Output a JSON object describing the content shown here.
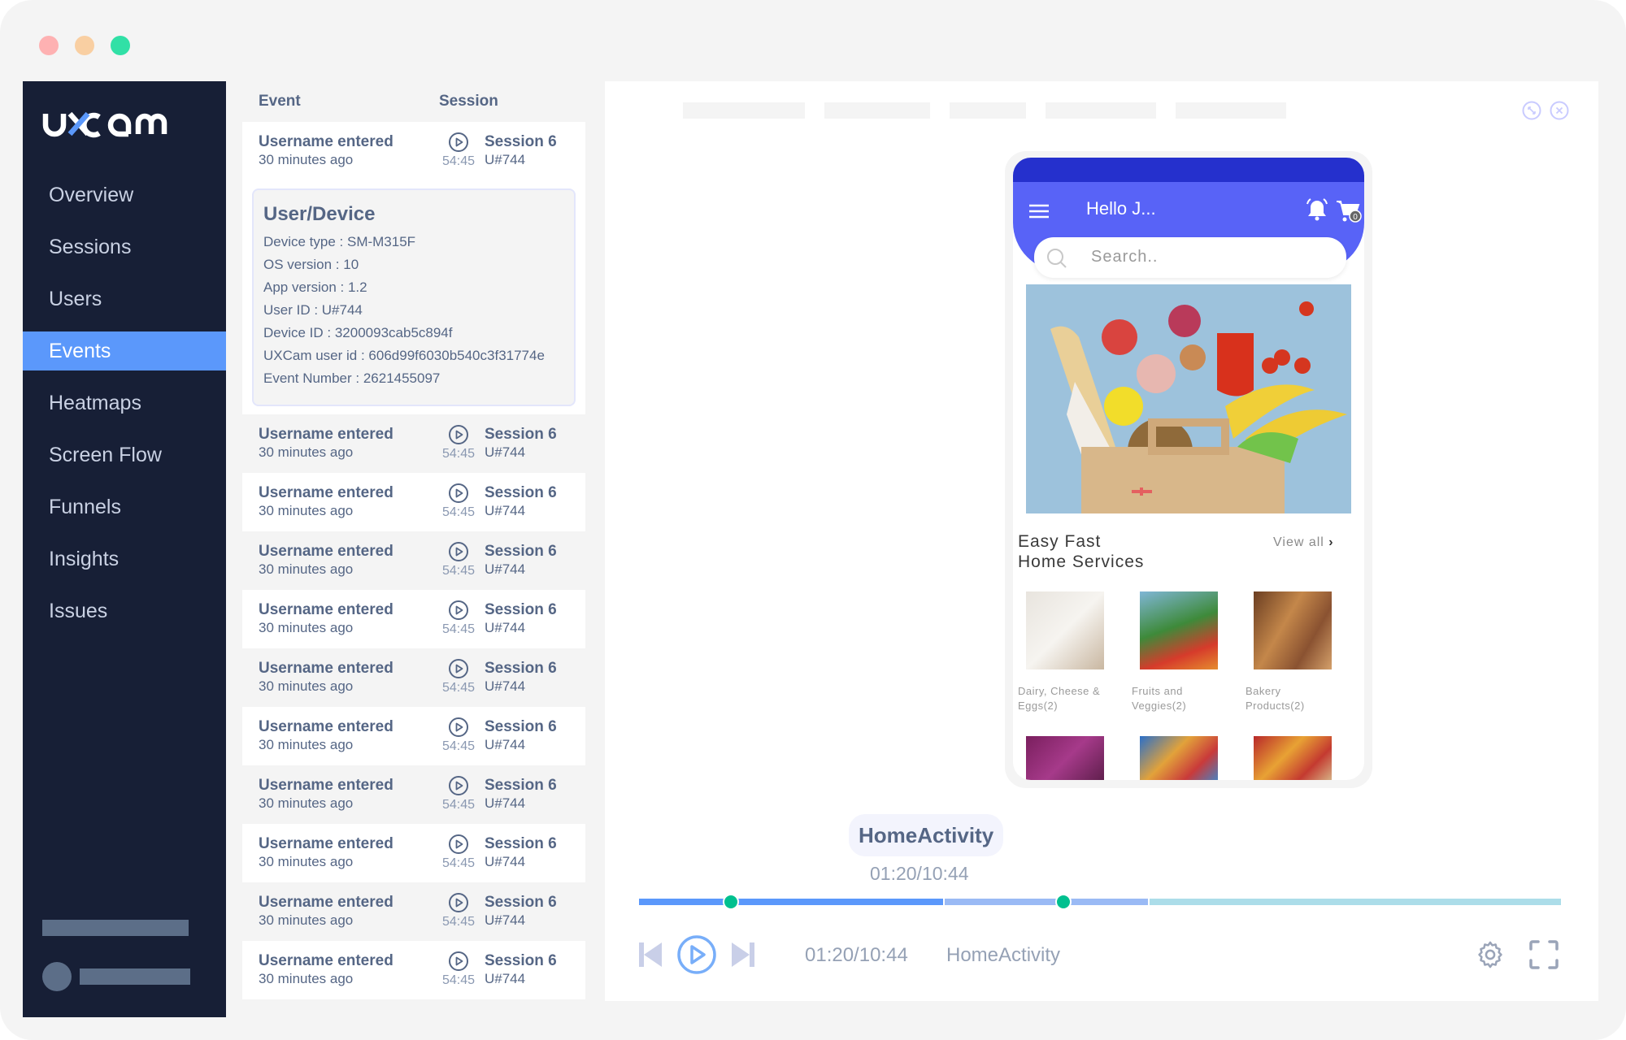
{
  "app": {
    "brand": "uxcam"
  },
  "window_controls": {
    "close_color": "#feb1b2",
    "minimize_color": "#f9cfa2",
    "maximize_color": "#31e0a6"
  },
  "sidebar": {
    "items": [
      {
        "label": "Overview",
        "active": false
      },
      {
        "label": "Sessions",
        "active": false
      },
      {
        "label": "Users",
        "active": false
      },
      {
        "label": "Events",
        "active": true
      },
      {
        "label": "Heatmaps",
        "active": false
      },
      {
        "label": "Screen Flow",
        "active": false
      },
      {
        "label": "Funnels",
        "active": false
      },
      {
        "label": "Insights",
        "active": false
      },
      {
        "label": "Issues",
        "active": false
      }
    ],
    "active_color": "#5b98fb"
  },
  "event_list": {
    "headers": {
      "event": "Event",
      "session": "Session"
    },
    "rows": [
      {
        "event": "Username entered",
        "time_ago": "30 minutes ago",
        "duration": "54:45",
        "session": "Session 6",
        "user": "U#744"
      },
      {
        "event": "Username entered",
        "time_ago": "30 minutes ago",
        "duration": "54:45",
        "session": "Session 6",
        "user": "U#744"
      },
      {
        "event": "Username entered",
        "time_ago": "30 minutes ago",
        "duration": "54:45",
        "session": "Session 6",
        "user": "U#744"
      },
      {
        "event": "Username entered",
        "time_ago": "30 minutes ago",
        "duration": "54:45",
        "session": "Session 6",
        "user": "U#744"
      },
      {
        "event": "Username entered",
        "time_ago": "30 minutes ago",
        "duration": "54:45",
        "session": "Session 6",
        "user": "U#744"
      },
      {
        "event": "Username entered",
        "time_ago": "30 minutes ago",
        "duration": "54:45",
        "session": "Session 6",
        "user": "U#744"
      },
      {
        "event": "Username entered",
        "time_ago": "30 minutes ago",
        "duration": "54:45",
        "session": "Session 6",
        "user": "U#744"
      },
      {
        "event": "Username entered",
        "time_ago": "30 minutes ago",
        "duration": "54:45",
        "session": "Session 6",
        "user": "U#744"
      },
      {
        "event": "Username entered",
        "time_ago": "30 minutes ago",
        "duration": "54:45",
        "session": "Session 6",
        "user": "U#744"
      },
      {
        "event": "Username entered",
        "time_ago": "30 minutes ago",
        "duration": "54:45",
        "session": "Session 6",
        "user": "U#744"
      },
      {
        "event": "Username entered",
        "time_ago": "30 minutes ago",
        "duration": "54:45",
        "session": "Session 6",
        "user": "U#744"
      }
    ],
    "detail": {
      "title": "User/Device",
      "lines": [
        "Device type : SM-M315F",
        "OS version : 10",
        "App version : 1.2",
        "User ID : U#744",
        "Device ID : 3200093cab5c894f",
        "UXCam user id : 606d99f6030b540c3f31774e",
        "Event Number : 2621455097"
      ]
    }
  },
  "player": {
    "icons": [
      "expand-icon",
      "close-icon"
    ],
    "phone": {
      "greeting": "Hello J...",
      "cart_count": "0",
      "search_placeholder": "Search..",
      "section_title_line1": "Easy Fast",
      "section_title_line2": "Home Services",
      "view_all": "View all",
      "categories": [
        {
          "line1": "Dairy, Cheese &",
          "line2": "Eggs(2)"
        },
        {
          "line1": "Fruits and",
          "line2": "Veggies(2)"
        },
        {
          "line1": "Bakery",
          "line2": "Products(2)"
        }
      ],
      "app_colors": {
        "status_bar": "#2530cd",
        "app_bar": "#5863f7"
      }
    },
    "current_activity": "HomeActivity",
    "current_time": "01:20/10:44",
    "timeline": {
      "played_fraction": 0.33,
      "segments": [
        {
          "end": 0.33,
          "color": "#5b98fb"
        },
        {
          "end": 0.552,
          "color": "#9abaf5"
        },
        {
          "end": 1.0,
          "color": "#acdde9"
        }
      ],
      "markers": [
        0.1,
        0.46
      ],
      "marker_color": "#00c08f"
    },
    "controls": {
      "time": "01:20/10:44",
      "activity": "HomeActivity",
      "play_color": "#78aef9"
    }
  }
}
